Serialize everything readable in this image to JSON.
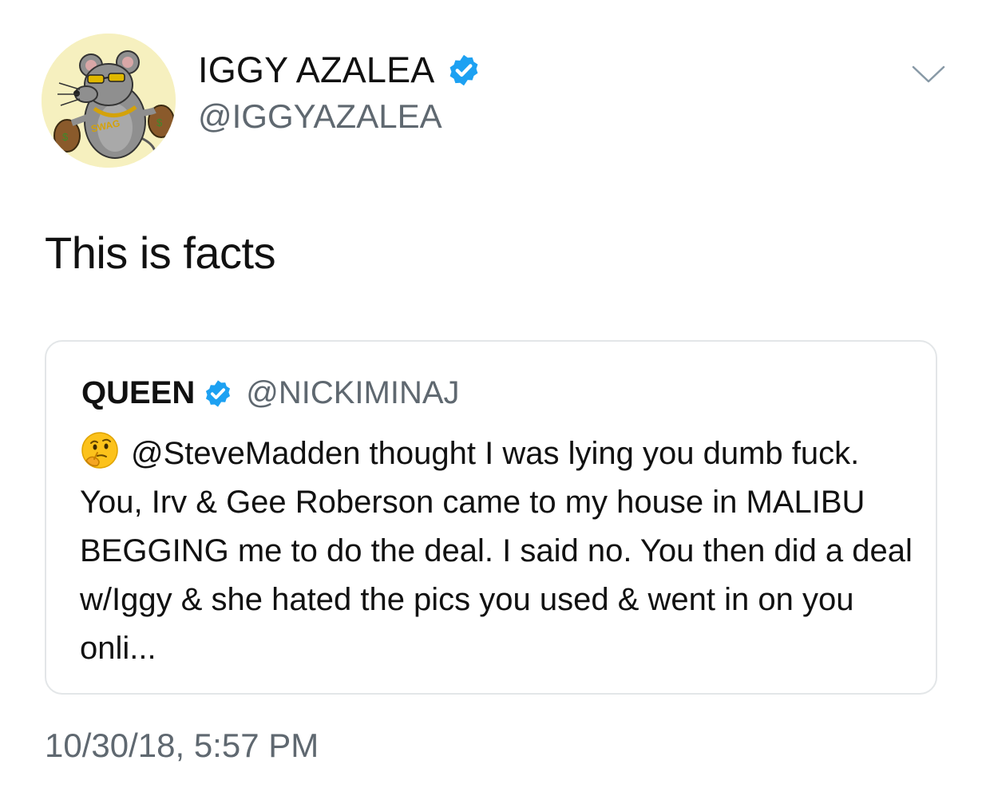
{
  "tweet": {
    "author": {
      "display_name": "IGGY AZALEA",
      "handle": "@IGGYAZALEA",
      "verified": true,
      "avatar_icon": "cartoon-rat-avatar-icon",
      "avatar_text": "SWAG"
    },
    "text": "This is facts",
    "timestamp": "10/30/18, 5:57 PM",
    "menu_icon": "chevron-down-icon"
  },
  "quoted_tweet": {
    "author": {
      "display_name": "QUEEN",
      "handle": "@NICKIMINAJ",
      "verified": true
    },
    "emoji": "thinking-face-icon",
    "text": "@SteveMadden thought I was lying you dumb fuck. You, Irv & Gee Roberson came to my house in MALIBU BEGGING me to do the deal. I said no. You then did a deal w/Iggy & she hated the pics you used & went in on you onli..."
  },
  "colors": {
    "verified_blue": "#1da1f2",
    "secondary_text": "#5f6870",
    "card_border": "#e3e6e8",
    "avatar_bg": "#f6f0bf"
  }
}
